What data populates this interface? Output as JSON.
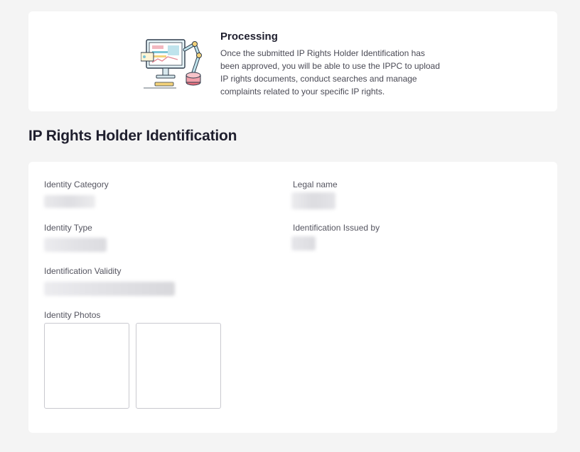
{
  "banner": {
    "illustration_icon": "computer-workstation-illustration",
    "title": "Processing",
    "description": "Once the submitted IP Rights Holder Identification has been approved, you will be able to use the IPPC to upload IP rights documents, conduct searches and manage complaints related to your specific IP rights."
  },
  "section": {
    "title": "IP Rights Holder Identification"
  },
  "details": {
    "identity_category_label": "Identity Category",
    "legal_name_label": "Legal name",
    "identity_type_label": "Identity Type",
    "identification_issued_by_label": "Identification Issued by",
    "identification_validity_label": "Identification Validity",
    "identity_photos_label": "Identity Photos"
  },
  "colors": {
    "background": "#f4f4f4",
    "card": "#ffffff",
    "title": "#1f1f2e"
  }
}
